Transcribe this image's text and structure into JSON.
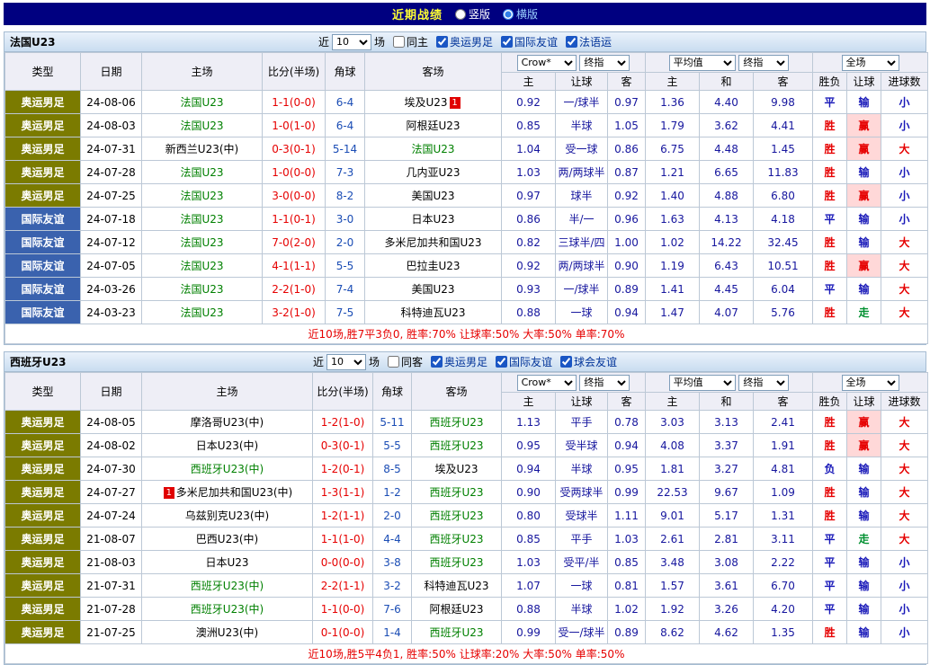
{
  "top_bar": {
    "title": "近期战绩",
    "layout_options": [
      {
        "label": "竖版",
        "selected": false
      },
      {
        "label": "横版",
        "selected": true
      }
    ]
  },
  "colors": {
    "self_team": "#008000",
    "score": "#e60000",
    "corner": "#1b4db5",
    "odds": "#16169e",
    "type_bg": {
      "奥运男足": "#7b7b00",
      "国际友谊": "#3a62ae"
    },
    "result_text": {
      "胜": "#e60000",
      "平": "#1717b8",
      "负": "#1717b8",
      "赢": "#e60000",
      "输": "#1717b8",
      "走": "#009030",
      "大": "#e60000",
      "小": "#1717b8"
    },
    "result_bg": {
      "赢": "#ffd8d8"
    }
  },
  "sections": [
    {
      "team": "法国U23",
      "filter": {
        "near_label": "近",
        "games_value": "10",
        "games_suffix": "场",
        "same_option": {
          "label": "同主",
          "checked": false
        },
        "competitions": [
          {
            "label": "奥运男足",
            "checked": true
          },
          {
            "label": "国际友谊",
            "checked": true
          },
          {
            "label": "法语运",
            "checked": true
          }
        ]
      },
      "header": {
        "type": "类型",
        "date": "日期",
        "home": "主场",
        "score": "比分(半场)",
        "corner": "角球",
        "away": "客场",
        "asian_book_select": "Crow*",
        "asian_time_select": "终指",
        "avg_select": "平均值",
        "avg_time_select": "终指",
        "full_select": "全场",
        "sub": [
          "主",
          "让球",
          "客",
          "主",
          "和",
          "客",
          "胜负",
          "让球",
          "进球数"
        ]
      },
      "rows": [
        {
          "type": "奥运男足",
          "date": "24-08-06",
          "home": "法国U23",
          "home_self": true,
          "score": "1-1(0-0)",
          "corner": "6-4",
          "away": "埃及U23",
          "away_badge": "1",
          "odds": [
            "0.92",
            "一/球半",
            "0.97",
            "1.36",
            "4.40",
            "9.98"
          ],
          "result": "平",
          "handicap": "输",
          "goals": "小"
        },
        {
          "type": "奥运男足",
          "date": "24-08-03",
          "home": "法国U23",
          "home_self": true,
          "score": "1-0(1-0)",
          "corner": "6-4",
          "away": "阿根廷U23",
          "odds": [
            "0.85",
            "半球",
            "1.05",
            "1.79",
            "3.62",
            "4.41"
          ],
          "result": "胜",
          "handicap": "赢",
          "goals": "小"
        },
        {
          "type": "奥运男足",
          "date": "24-07-31",
          "home": "新西兰U23(中)",
          "score": "0-3(0-1)",
          "corner": "5-14",
          "away": "法国U23",
          "away_self": true,
          "odds": [
            "1.04",
            "受一球",
            "0.86",
            "6.75",
            "4.48",
            "1.45"
          ],
          "result": "胜",
          "handicap": "赢",
          "goals": "大"
        },
        {
          "type": "奥运男足",
          "date": "24-07-28",
          "home": "法国U23",
          "home_self": true,
          "score": "1-0(0-0)",
          "corner": "7-3",
          "away": "几内亚U23",
          "odds": [
            "1.03",
            "两/两球半",
            "0.87",
            "1.21",
            "6.65",
            "11.83"
          ],
          "result": "胜",
          "handicap": "输",
          "goals": "小"
        },
        {
          "type": "奥运男足",
          "date": "24-07-25",
          "home": "法国U23",
          "home_self": true,
          "score": "3-0(0-0)",
          "corner": "8-2",
          "away": "美国U23",
          "odds": [
            "0.97",
            "球半",
            "0.92",
            "1.40",
            "4.88",
            "6.80"
          ],
          "result": "胜",
          "handicap": "赢",
          "goals": "小"
        },
        {
          "type": "国际友谊",
          "date": "24-07-18",
          "home": "法国U23",
          "home_self": true,
          "score": "1-1(0-1)",
          "corner": "3-0",
          "away": "日本U23",
          "odds": [
            "0.86",
            "半/一",
            "0.96",
            "1.63",
            "4.13",
            "4.18"
          ],
          "result": "平",
          "handicap": "输",
          "goals": "小"
        },
        {
          "type": "国际友谊",
          "date": "24-07-12",
          "home": "法国U23",
          "home_self": true,
          "score": "7-0(2-0)",
          "corner": "2-0",
          "away": "多米尼加共和国U23",
          "odds": [
            "0.82",
            "三球半/四",
            "1.00",
            "1.02",
            "14.22",
            "32.45"
          ],
          "result": "胜",
          "handicap": "输",
          "goals": "大"
        },
        {
          "type": "国际友谊",
          "date": "24-07-05",
          "home": "法国U23",
          "home_self": true,
          "score": "4-1(1-1)",
          "corner": "5-5",
          "away": "巴拉圭U23",
          "odds": [
            "0.92",
            "两/两球半",
            "0.90",
            "1.19",
            "6.43",
            "10.51"
          ],
          "result": "胜",
          "handicap": "赢",
          "goals": "大"
        },
        {
          "type": "国际友谊",
          "date": "24-03-26",
          "home": "法国U23",
          "home_self": true,
          "score": "2-2(1-0)",
          "corner": "7-4",
          "away": "美国U23",
          "odds": [
            "0.93",
            "一/球半",
            "0.89",
            "1.41",
            "4.45",
            "6.04"
          ],
          "result": "平",
          "handicap": "输",
          "goals": "大"
        },
        {
          "type": "国际友谊",
          "date": "24-03-23",
          "home": "法国U23",
          "home_self": true,
          "score": "3-2(1-0)",
          "corner": "7-5",
          "away": "科特迪瓦U23",
          "odds": [
            "0.88",
            "一球",
            "0.94",
            "1.47",
            "4.07",
            "5.76"
          ],
          "result": "胜",
          "handicap": "走",
          "goals": "大"
        }
      ],
      "summary": "近10场,胜7平3负0, 胜率:70% 让球率:50% 大率:50% 单率:70%"
    },
    {
      "team": "西班牙U23",
      "filter": {
        "near_label": "近",
        "games_value": "10",
        "games_suffix": "场",
        "same_option": {
          "label": "同客",
          "checked": false
        },
        "competitions": [
          {
            "label": "奥运男足",
            "checked": true
          },
          {
            "label": "国际友谊",
            "checked": true
          },
          {
            "label": "球会友谊",
            "checked": true
          }
        ]
      },
      "header": {
        "type": "类型",
        "date": "日期",
        "home": "主场",
        "score": "比分(半场)",
        "corner": "角球",
        "away": "客场",
        "asian_book_select": "Crow*",
        "asian_time_select": "终指",
        "avg_select": "平均值",
        "avg_time_select": "终指",
        "full_select": "全场",
        "sub": [
          "主",
          "让球",
          "客",
          "主",
          "和",
          "客",
          "胜负",
          "让球",
          "进球数"
        ]
      },
      "rows": [
        {
          "type": "奥运男足",
          "date": "24-08-05",
          "home": "摩洛哥U23(中)",
          "score": "1-2(1-0)",
          "corner": "5-11",
          "away": "西班牙U23",
          "away_self": true,
          "odds": [
            "1.13",
            "平手",
            "0.78",
            "3.03",
            "3.13",
            "2.41"
          ],
          "result": "胜",
          "handicap": "赢",
          "goals": "大"
        },
        {
          "type": "奥运男足",
          "date": "24-08-02",
          "home": "日本U23(中)",
          "score": "0-3(0-1)",
          "corner": "5-5",
          "away": "西班牙U23",
          "away_self": true,
          "odds": [
            "0.95",
            "受半球",
            "0.94",
            "4.08",
            "3.37",
            "1.91"
          ],
          "result": "胜",
          "handicap": "赢",
          "goals": "大"
        },
        {
          "type": "奥运男足",
          "date": "24-07-30",
          "home": "西班牙U23(中)",
          "home_self": true,
          "score": "1-2(0-1)",
          "corner": "8-5",
          "away": "埃及U23",
          "odds": [
            "0.94",
            "半球",
            "0.95",
            "1.81",
            "3.27",
            "4.81"
          ],
          "result": "负",
          "handicap": "输",
          "goals": "大"
        },
        {
          "type": "奥运男足",
          "date": "24-07-27",
          "home": "多米尼加共和国U23(中)",
          "home_badge": "1",
          "score": "1-3(1-1)",
          "corner": "1-2",
          "away": "西班牙U23",
          "away_self": true,
          "odds": [
            "0.90",
            "受两球半",
            "0.99",
            "22.53",
            "9.67",
            "1.09"
          ],
          "result": "胜",
          "handicap": "输",
          "goals": "大"
        },
        {
          "type": "奥运男足",
          "date": "24-07-24",
          "home": "乌兹别克U23(中)",
          "score": "1-2(1-1)",
          "corner": "2-0",
          "away": "西班牙U23",
          "away_self": true,
          "odds": [
            "0.80",
            "受球半",
            "1.11",
            "9.01",
            "5.17",
            "1.31"
          ],
          "result": "胜",
          "handicap": "输",
          "goals": "大"
        },
        {
          "type": "奥运男足",
          "date": "21-08-07",
          "home": "巴西U23(中)",
          "score": "1-1(1-0)",
          "corner": "4-4",
          "away": "西班牙U23",
          "away_self": true,
          "odds": [
            "0.85",
            "平手",
            "1.03",
            "2.61",
            "2.81",
            "3.11"
          ],
          "result": "平",
          "handicap": "走",
          "goals": "大"
        },
        {
          "type": "奥运男足",
          "date": "21-08-03",
          "home": "日本U23",
          "score": "0-0(0-0)",
          "corner": "3-8",
          "away": "西班牙U23",
          "away_self": true,
          "odds": [
            "1.03",
            "受平/半",
            "0.85",
            "3.48",
            "3.08",
            "2.22"
          ],
          "result": "平",
          "handicap": "输",
          "goals": "小"
        },
        {
          "type": "奥运男足",
          "date": "21-07-31",
          "home": "西班牙U23(中)",
          "home_self": true,
          "score": "2-2(1-1)",
          "corner": "3-2",
          "away": "科特迪瓦U23",
          "odds": [
            "1.07",
            "一球",
            "0.81",
            "1.57",
            "3.61",
            "6.70"
          ],
          "result": "平",
          "handicap": "输",
          "goals": "小"
        },
        {
          "type": "奥运男足",
          "date": "21-07-28",
          "home": "西班牙U23(中)",
          "home_self": true,
          "score": "1-1(0-0)",
          "corner": "7-6",
          "away": "阿根廷U23",
          "odds": [
            "0.88",
            "半球",
            "1.02",
            "1.92",
            "3.26",
            "4.20"
          ],
          "result": "平",
          "handicap": "输",
          "goals": "小"
        },
        {
          "type": "奥运男足",
          "date": "21-07-25",
          "home": "澳洲U23(中)",
          "score": "0-1(0-0)",
          "corner": "1-4",
          "away": "西班牙U23",
          "away_self": true,
          "odds": [
            "0.99",
            "受一/球半",
            "0.89",
            "8.62",
            "4.62",
            "1.35"
          ],
          "result": "胜",
          "handicap": "输",
          "goals": "小"
        }
      ],
      "summary": "近10场,胜5平4负1, 胜率:50% 让球率:20% 大率:50% 单率:50%"
    }
  ]
}
